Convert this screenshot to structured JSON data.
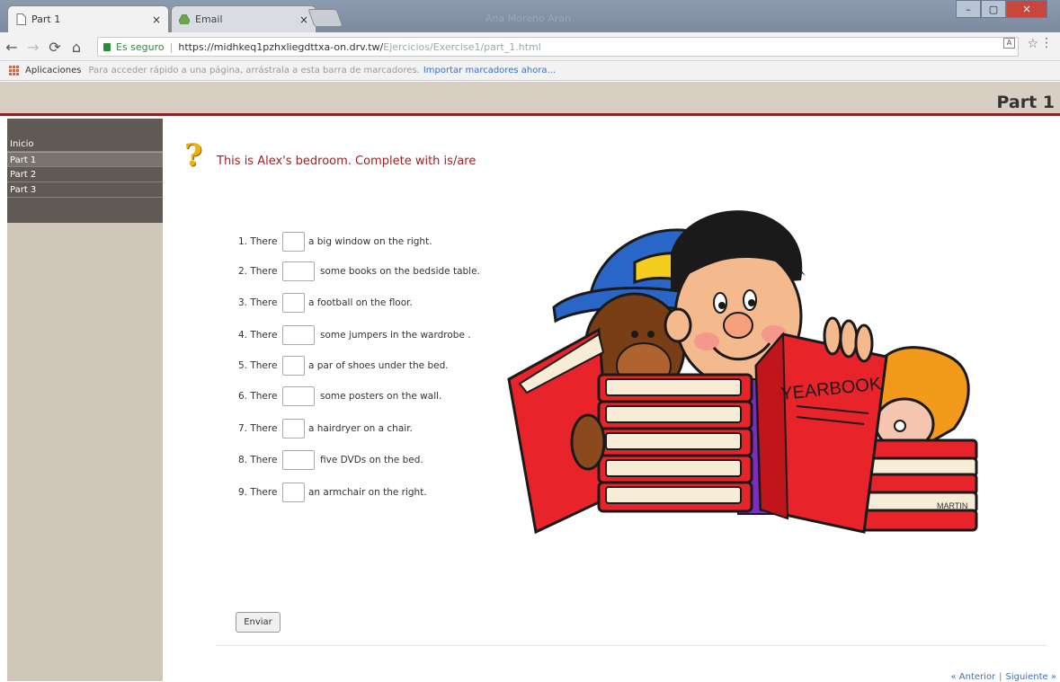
{
  "browser": {
    "tabs": [
      {
        "title": "Part 1",
        "active": true
      },
      {
        "title": "Email",
        "active": false
      }
    ],
    "window_title_faint": "Ana Moreno Aran",
    "secure_label": "Es seguro",
    "url_host": "https://midhkeq1pzhxliegdttxa-on.drv.tw/",
    "url_path": "Ejercicios/Exercise1/part_1.html",
    "bookmarks": {
      "apps_label": "Aplicaciones",
      "hint": "Para acceder rápido a una página, arrástrala a esta barra de marcadores.",
      "import_link": "Importar marcadores ahora..."
    }
  },
  "page": {
    "header_title": "Part 1",
    "sidebar": [
      "Inicio",
      "Part 1",
      "Part 2",
      "Part 3"
    ],
    "instruction": "This is Alex's bedroom. Complete with is/are",
    "exercises": [
      {
        "num": "1. There",
        "rest": "a big window on the right.",
        "value": ""
      },
      {
        "num": "2. There",
        "rest": "some books on the bedside table.",
        "value": ""
      },
      {
        "num": "3. There",
        "rest": "a football on the floor.",
        "value": ""
      },
      {
        "num": "4. There",
        "rest": "some jumpers in the wardrobe .",
        "value": ""
      },
      {
        "num": "5. There",
        "rest": "a par of shoes under the bed.",
        "value": ""
      },
      {
        "num": "6. There",
        "rest": "some posters on the wall.",
        "value": ""
      },
      {
        "num": "7. There",
        "rest": "a hairdryer on a chair.",
        "value": ""
      },
      {
        "num": "8. There",
        "rest": "five DVDs on the bed.",
        "value": ""
      },
      {
        "num": "9. There",
        "rest": "an armchair on the right.",
        "value": ""
      }
    ],
    "submit_label": "Enviar",
    "pager": {
      "prev": "« Anterior",
      "sep": "|",
      "next": "Siguiente »"
    },
    "illustration": {
      "yearbook_text": "YEARBOOK",
      "signature": "MARTIN"
    }
  }
}
